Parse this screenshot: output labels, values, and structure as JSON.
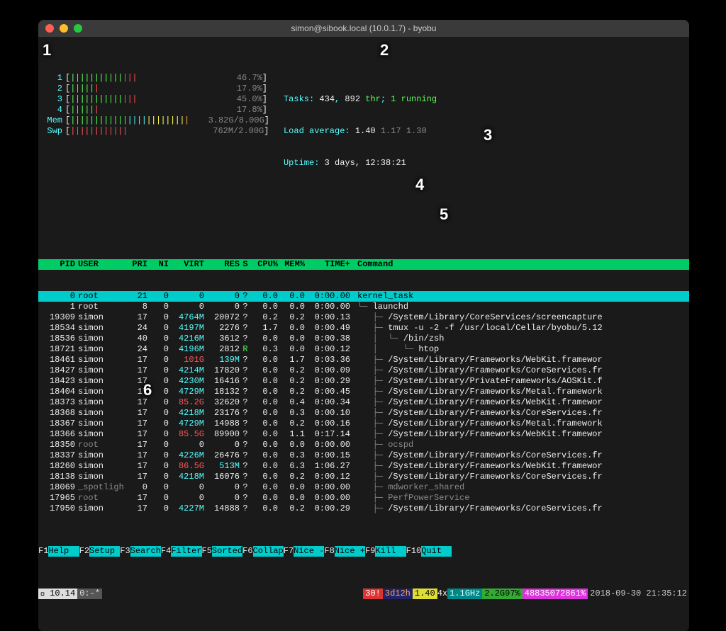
{
  "title": "simon@sibook.local (10.0.1.7) - byobu",
  "meters": [
    {
      "label": "1",
      "type": "cpu",
      "pct": "46.7%",
      "bars": [
        [
          "green",
          11
        ],
        [
          "red",
          3
        ],
        [
          "gray",
          0
        ]
      ]
    },
    {
      "label": "2",
      "type": "cpu",
      "pct": "17.9%",
      "bars": [
        [
          "green",
          5
        ],
        [
          "red",
          1
        ],
        [
          "gray",
          0
        ]
      ]
    },
    {
      "label": "3",
      "type": "cpu",
      "pct": "45.0%",
      "bars": [
        [
          "green",
          11
        ],
        [
          "red",
          3
        ],
        [
          "gray",
          0
        ]
      ]
    },
    {
      "label": "4",
      "type": "cpu",
      "pct": "17.8%",
      "bars": [
        [
          "green",
          5
        ],
        [
          "red",
          1
        ],
        [
          "gray",
          0
        ]
      ]
    },
    {
      "label": "Mem",
      "type": "mem",
      "pct": "3.82G/8.00G",
      "bars": [
        [
          "green",
          12
        ],
        [
          "cyan",
          4
        ],
        [
          "yellow",
          8
        ],
        [
          "orange",
          1
        ]
      ]
    },
    {
      "label": "Swp",
      "type": "swp",
      "pct": "762M/2.00G",
      "bars": [
        [
          "red",
          12
        ]
      ]
    }
  ],
  "tasks": {
    "procs": "434",
    "threads": "892",
    "running": "1"
  },
  "load": {
    "l1": "1.40",
    "l5": "1.17",
    "l15": "1.30"
  },
  "uptime": "3 days, 12:38:21",
  "columns": [
    "PID",
    "USER",
    "PRI",
    "NI",
    "VIRT",
    "RES",
    "S",
    "CPU%",
    "MEM%",
    "TIME+",
    "Command"
  ],
  "processes": [
    {
      "pid": "0",
      "user": "root",
      "pri": "21",
      "ni": "0",
      "virt": "0",
      "res": "0",
      "s": "?",
      "cpu": "0.0",
      "mem": "0.0",
      "time": "0:00.00",
      "cmd": "kernel_task",
      "hl": true,
      "depth": 0
    },
    {
      "pid": "1",
      "user": "root",
      "pri": "8",
      "ni": "0",
      "virt": "0",
      "res": "0",
      "s": "?",
      "cpu": "0.0",
      "mem": "0.0",
      "time": "0:00.00",
      "cmd": "launchd",
      "depth": 1
    },
    {
      "pid": "19309",
      "user": "simon",
      "pri": "17",
      "ni": "0",
      "virt": "4764M",
      "res": "20072",
      "s": "?",
      "cpu": "0.2",
      "mem": "0.2",
      "time": "0:00.13",
      "cmd": "/System/Library/CoreServices/screencapture",
      "depth": 2
    },
    {
      "pid": "18534",
      "user": "simon",
      "pri": "24",
      "ni": "0",
      "virt": "4197M",
      "res": "2276",
      "s": "?",
      "cpu": "1.7",
      "mem": "0.0",
      "time": "0:00.49",
      "cmd": "tmux -u -2 -f /usr/local/Cellar/byobu/5.12",
      "depth": 2
    },
    {
      "pid": "18536",
      "user": "simon",
      "pri": "40",
      "ni": "0",
      "virt": "4216M",
      "res": "3612",
      "s": "?",
      "cpu": "0.0",
      "mem": "0.0",
      "time": "0:00.38",
      "cmd": "/bin/zsh",
      "depth": 3
    },
    {
      "pid": "18721",
      "user": "simon",
      "pri": "24",
      "ni": "0",
      "virt": "4196M",
      "res": "2812",
      "s": "R",
      "cpu": "0.3",
      "mem": "0.0",
      "time": "0:00.12",
      "cmd": "htop",
      "depth": 4,
      "sR": true
    },
    {
      "pid": "18461",
      "user": "simon",
      "pri": "17",
      "ni": "0",
      "virt": "101G",
      "res": "139M",
      "s": "?",
      "cpu": "0.0",
      "mem": "1.7",
      "time": "0:03.36",
      "cmd": "/System/Library/Frameworks/WebKit.framewor",
      "depth": 2,
      "virtRed": true
    },
    {
      "pid": "18427",
      "user": "simon",
      "pri": "17",
      "ni": "0",
      "virt": "4214M",
      "res": "17820",
      "s": "?",
      "cpu": "0.0",
      "mem": "0.2",
      "time": "0:00.09",
      "cmd": "/System/Library/Frameworks/CoreServices.fr",
      "depth": 2
    },
    {
      "pid": "18423",
      "user": "simon",
      "pri": "17",
      "ni": "0",
      "virt": "4230M",
      "res": "16416",
      "s": "?",
      "cpu": "0.0",
      "mem": "0.2",
      "time": "0:00.29",
      "cmd": "/System/Library/PrivateFrameworks/AOSKit.f",
      "depth": 2
    },
    {
      "pid": "18404",
      "user": "simon",
      "pri": "17",
      "ni": "0",
      "virt": "4729M",
      "res": "18132",
      "s": "?",
      "cpu": "0.0",
      "mem": "0.2",
      "time": "0:00.45",
      "cmd": "/System/Library/Frameworks/Metal.framework",
      "depth": 2
    },
    {
      "pid": "18373",
      "user": "simon",
      "pri": "17",
      "ni": "0",
      "virt": "85.2G",
      "res": "32620",
      "s": "?",
      "cpu": "0.0",
      "mem": "0.4",
      "time": "0:00.34",
      "cmd": "/System/Library/Frameworks/WebKit.framewor",
      "depth": 2,
      "virtRed": true
    },
    {
      "pid": "18368",
      "user": "simon",
      "pri": "17",
      "ni": "0",
      "virt": "4218M",
      "res": "23176",
      "s": "?",
      "cpu": "0.0",
      "mem": "0.3",
      "time": "0:00.10",
      "cmd": "/System/Library/Frameworks/CoreServices.fr",
      "depth": 2
    },
    {
      "pid": "18367",
      "user": "simon",
      "pri": "17",
      "ni": "0",
      "virt": "4729M",
      "res": "14988",
      "s": "?",
      "cpu": "0.0",
      "mem": "0.2",
      "time": "0:00.16",
      "cmd": "/System/Library/Frameworks/Metal.framework",
      "depth": 2
    },
    {
      "pid": "18366",
      "user": "simon",
      "pri": "17",
      "ni": "0",
      "virt": "85.5G",
      "res": "89900",
      "s": "?",
      "cpu": "0.0",
      "mem": "1.1",
      "time": "0:17.14",
      "cmd": "/System/Library/Frameworks/WebKit.framewor",
      "depth": 2,
      "virtRed": true
    },
    {
      "pid": "18350",
      "user": "root",
      "pri": "17",
      "ni": "0",
      "virt": "0",
      "res": "0",
      "s": "?",
      "cpu": "0.0",
      "mem": "0.0",
      "time": "0:00.00",
      "cmd": "ocspd",
      "depth": 2,
      "dim": true
    },
    {
      "pid": "18337",
      "user": "simon",
      "pri": "17",
      "ni": "0",
      "virt": "4226M",
      "res": "26476",
      "s": "?",
      "cpu": "0.0",
      "mem": "0.3",
      "time": "0:00.15",
      "cmd": "/System/Library/Frameworks/CoreServices.fr",
      "depth": 2
    },
    {
      "pid": "18260",
      "user": "simon",
      "pri": "17",
      "ni": "0",
      "virt": "86.5G",
      "res": "513M",
      "s": "?",
      "cpu": "0.0",
      "mem": "6.3",
      "time": "1:06.27",
      "cmd": "/System/Library/Frameworks/WebKit.framewor",
      "depth": 2,
      "virtRed": true
    },
    {
      "pid": "18138",
      "user": "simon",
      "pri": "17",
      "ni": "0",
      "virt": "4218M",
      "res": "16076",
      "s": "?",
      "cpu": "0.0",
      "mem": "0.2",
      "time": "0:00.12",
      "cmd": "/System/Library/Frameworks/CoreServices.fr",
      "depth": 2
    },
    {
      "pid": "18069",
      "user": "_spotligh",
      "pri": "0",
      "ni": "0",
      "virt": "0",
      "res": "0",
      "s": "?",
      "cpu": "0.0",
      "mem": "0.0",
      "time": "0:00.00",
      "cmd": "mdworker_shared",
      "depth": 2,
      "dim": true
    },
    {
      "pid": "17965",
      "user": "root",
      "pri": "17",
      "ni": "0",
      "virt": "0",
      "res": "0",
      "s": "?",
      "cpu": "0.0",
      "mem": "0.0",
      "time": "0:00.00",
      "cmd": "PerfPowerService",
      "depth": 2,
      "dim": true
    },
    {
      "pid": "17950",
      "user": "simon",
      "pri": "17",
      "ni": "0",
      "virt": "4227M",
      "res": "14888",
      "s": "?",
      "cpu": "0.0",
      "mem": "0.2",
      "time": "0:00.29",
      "cmd": "/System/Library/Frameworks/CoreServices.fr",
      "depth": 2
    }
  ],
  "fnkeys": [
    {
      "key": "F1",
      "label": "Help  "
    },
    {
      "key": "F2",
      "label": "Setup "
    },
    {
      "key": "F3",
      "label": "Search"
    },
    {
      "key": "F4",
      "label": "Filter"
    },
    {
      "key": "F5",
      "label": "Sorted"
    },
    {
      "key": "F6",
      "label": "Collap"
    },
    {
      "key": "F7",
      "label": "Nice -"
    },
    {
      "key": "F8",
      "label": "Nice +"
    },
    {
      "key": "F9",
      "label": "Kill  "
    },
    {
      "key": "F10",
      "label": "Quit  "
    }
  ],
  "status": {
    "osver": "10.14",
    "session": "0:-*",
    "red": "30!",
    "uptime": "3d12h",
    "load": "1.40",
    "cores": "4x",
    "cpu": "1.1GHz",
    "cpuuse": "2.2G97%",
    "mem": "48835072861%",
    "datetime": "2018-09-30 21:35:12"
  },
  "annotations": [
    "1",
    "2",
    "3",
    "4",
    "5",
    "6"
  ]
}
